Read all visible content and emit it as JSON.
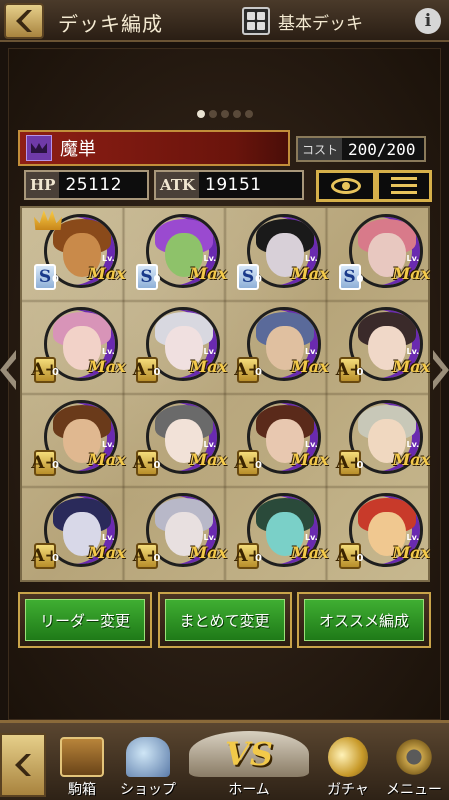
{
  "header": {
    "title": "デッキ編成",
    "deck_name": "基本デッキ",
    "icons": {
      "back": "chevron-left-icon",
      "deck": "deck-grid-icon",
      "info": "info-icon"
    }
  },
  "pagination": {
    "total": 5,
    "active": 0
  },
  "deck": {
    "party_name": "魔単",
    "cost_label": "コスト",
    "cost_value": "200/200",
    "hp_label": "HP",
    "hp_value": "25112",
    "atk_label": "ATK",
    "atk_value": "19151"
  },
  "cards": [
    {
      "rank": "S",
      "rank_sub": "0",
      "level": "Max",
      "leader": true,
      "hair": "#8a4a1a",
      "face": "#c98a4a"
    },
    {
      "rank": "S",
      "rank_sub": "0",
      "level": "Max",
      "leader": false,
      "hair": "#9a4ad0",
      "face": "#8ec26a"
    },
    {
      "rank": "S",
      "rank_sub": "0",
      "level": "Max",
      "leader": false,
      "hair": "#1a1a1a",
      "face": "#d8d0d8"
    },
    {
      "rank": "S",
      "rank_sub": "0",
      "level": "Max",
      "leader": false,
      "hair": "#d87a8a",
      "face": "#e8c8c0"
    },
    {
      "rank": "A+",
      "rank_sub": "0",
      "level": "Max",
      "leader": false,
      "hair": "#d894b8",
      "face": "#f2d2c8"
    },
    {
      "rank": "A+",
      "rank_sub": "0",
      "level": "Max",
      "leader": false,
      "hair": "#d8d8e0",
      "face": "#f0e0e0"
    },
    {
      "rank": "A+",
      "rank_sub": "0",
      "level": "Max",
      "leader": false,
      "hair": "#5a6a9a",
      "face": "#e0c0a0"
    },
    {
      "rank": "A+",
      "rank_sub": "0",
      "level": "Max",
      "leader": false,
      "hair": "#3a2a2a",
      "face": "#f0d8c8"
    },
    {
      "rank": "A+",
      "rank_sub": "0",
      "level": "Max",
      "leader": false,
      "hair": "#6a3a1a",
      "face": "#e0b890"
    },
    {
      "rank": "A+",
      "rank_sub": "0",
      "level": "Max",
      "leader": false,
      "hair": "#6a6a6a",
      "face": "#f2e2d8"
    },
    {
      "rank": "A+",
      "rank_sub": "0",
      "level": "Max",
      "leader": false,
      "hair": "#5a2a1a",
      "face": "#e8c8b0"
    },
    {
      "rank": "A+",
      "rank_sub": "0",
      "level": "Max",
      "leader": false,
      "hair": "#c8c8b8",
      "face": "#f0d8c0"
    },
    {
      "rank": "A+",
      "rank_sub": "0",
      "level": "Max",
      "leader": false,
      "hair": "#2a2a5a",
      "face": "#d8d8e8"
    },
    {
      "rank": "A+",
      "rank_sub": "0",
      "level": "Max",
      "leader": false,
      "hair": "#b8b8c8",
      "face": "#e8e0e0"
    },
    {
      "rank": "A+",
      "rank_sub": "0",
      "level": "Max",
      "leader": false,
      "hair": "#2a4a3a",
      "face": "#7ad0c8"
    },
    {
      "rank": "A+",
      "rank_sub": "0",
      "level": "Max",
      "leader": false,
      "hair": "#c83a2a",
      "face": "#f0c890"
    }
  ],
  "lv_label": "Lv.",
  "actions": {
    "leader_change": "リーダー変更",
    "bulk_change": "まとめて変更",
    "recommended": "オススメ編成"
  },
  "nav": {
    "box": "駒箱",
    "shop": "ショップ",
    "home": "ホーム",
    "home_badge": "VS",
    "gacha": "ガチャ",
    "menu": "メニュー"
  },
  "colors": {
    "accent_gold": "#c9a44a",
    "button_green": "#2f9a26",
    "banner_red": "#8e1e14"
  }
}
